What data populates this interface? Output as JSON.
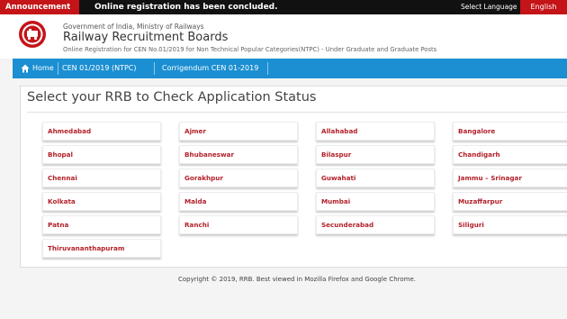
{
  "topbar": {
    "announcement": "Announcement",
    "message": "Online registration has been concluded.",
    "select_language": "Select Language",
    "language": "English"
  },
  "header": {
    "gov_line": "Government of India, Ministry of Railways",
    "title": "Railway Recruitment Boards",
    "subtitle": "Online Registration for CEN No.01/2019 for Non Technical Popular Categories(NTPC) - Under Graduate and Graduate Posts"
  },
  "nav": {
    "home": "Home",
    "tab1": "CEN 01/2019 (NTPC)",
    "tab2": "Corrigendum CEN 01-2019"
  },
  "page_title": "Select your RRB to Check Application Status",
  "rrbs": [
    "Ahmedabad",
    "Ajmer",
    "Allahabad",
    "Bangalore",
    "Bhopal",
    "Bhubaneswar",
    "Bilaspur",
    "Chandigarh",
    "Chennai",
    "Gorakhpur",
    "Guwahati",
    "Jammu – Srinagar",
    "Kolkata",
    "Malda",
    "Mumbai",
    "Muzaffarpur",
    "Patna",
    "Ranchi",
    "Secunderabad",
    "Siliguri",
    "Thiruvananthapuram"
  ],
  "footer": "Copyright © 2019, RRB. Best viewed in Mozilla Firefox and Google Chrome.",
  "colors": {
    "accent_red": "#c41418",
    "nav_blue": "#1b8fd2",
    "link_red": "#b3212a"
  }
}
